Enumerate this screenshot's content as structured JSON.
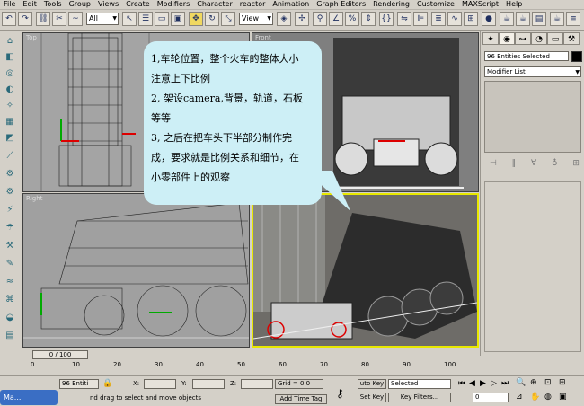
{
  "menu": [
    "File",
    "Edit",
    "Tools",
    "Group",
    "Views",
    "Create",
    "Modifiers",
    "Character",
    "reactor",
    "Animation",
    "Graph Editors",
    "Rendering",
    "Customize",
    "MAXScript",
    "Help"
  ],
  "toolbar": {
    "filter_select": "All",
    "view_select": "View"
  },
  "viewports": {
    "top_label": "Top",
    "front_label": "Front",
    "right_label": "Right",
    "persp_label": ""
  },
  "annotation": {
    "lines": [
      "1,车轮位置，整个火车的整体大小",
      "注意上下比例",
      "2, 架设camera,背景，轨道，石板",
      "等等",
      "3, 之后在把车头下半部分制作完",
      "成，要求就是比例关系和细节，在",
      "小零部件上的观察"
    ]
  },
  "command_panel": {
    "selection_name": "96 Entities Selected",
    "modifier_list": "Modifier List"
  },
  "timeline": {
    "slider": "0 / 100",
    "ticks": [
      "0",
      "10",
      "20",
      "30",
      "40",
      "50",
      "60",
      "70",
      "80",
      "90",
      "100"
    ]
  },
  "status": {
    "selected_count": "96 Entiti",
    "x_label": "X:",
    "y_label": "Y:",
    "z_label": "Z:",
    "grid": "Grid = 0.0",
    "auto_key": "uto Key",
    "selected_dropdown": "Selected",
    "set_key": "Set Key",
    "key_filters": "Key Filters...",
    "prompt": "nd drag to select and move objects",
    "add_time_tag": "Add Time Tag",
    "frame": "0"
  },
  "taskbar": {
    "label": "Ma..."
  },
  "colors": {
    "bubble": "#cdeff6",
    "active_border": "#e8e800",
    "viewport_bg": "#9c9c9c"
  }
}
